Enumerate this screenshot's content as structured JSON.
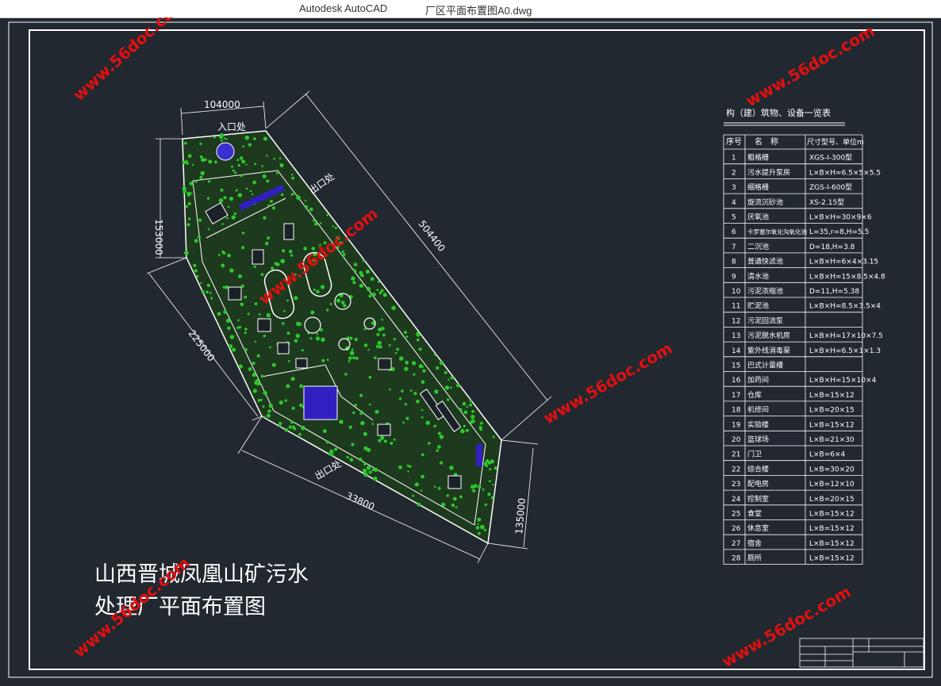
{
  "window": {
    "app_name": "Autodesk AutoCAD",
    "file_name": "厂区平面布置图A0.dwg"
  },
  "drawing": {
    "dimensions": [
      "104000",
      "153000",
      "504400",
      "225000",
      "33800",
      "135000"
    ],
    "labels": {
      "entrance": "入口处",
      "exit_1": "出口处",
      "exit_2": "出口处"
    },
    "title_line_1": "山西晋城凤凰山矿污水",
    "title_line_2": "处理厂平面布置图",
    "watermark": "www.56doc.com"
  },
  "table": {
    "title": "构（建）筑物、设备一览表",
    "headers": [
      "序号",
      "名　称",
      "尺寸型号、单位m"
    ],
    "rows": [
      [
        "1",
        "粗格栅",
        "XGS-I-300型"
      ],
      [
        "2",
        "污水提升泵房",
        "L×B×H=6.5×5×5.5"
      ],
      [
        "3",
        "细格栅",
        "ZGS-I-600型"
      ],
      [
        "4",
        "旋流沉砂池",
        "XS-2.15型"
      ],
      [
        "5",
        "厌氧池",
        "L×B×H=30×9×6"
      ],
      [
        "6",
        "卡罗塞尔氧化沟氧化池",
        "L=35,r=8,H=5.5"
      ],
      [
        "7",
        "二沉池",
        "D=18,H=3.8"
      ],
      [
        "8",
        "普通快滤池",
        "L×B×H=6×4×3.15"
      ],
      [
        "9",
        "清水池",
        "L×B×H=15×8.5×4.8"
      ],
      [
        "10",
        "污泥浓缩池",
        "D=11,H=5.38"
      ],
      [
        "11",
        "贮泥池",
        "L×B×H=8.5×3.5×4"
      ],
      [
        "12",
        "污泥回流泵",
        ""
      ],
      [
        "13",
        "污泥脱水机房",
        "L×B×H=17×10×7.5"
      ],
      [
        "14",
        "紫外线消毒渠",
        "L×B×H=6.5×1×1.3"
      ],
      [
        "15",
        "巴式计量槽",
        ""
      ],
      [
        "16",
        "加药间",
        "L×B×H=15×10×4"
      ],
      [
        "17",
        "仓库",
        "L×B=15×12"
      ],
      [
        "18",
        "机修间",
        "L×B=20×15"
      ],
      [
        "19",
        "实验楼",
        "L×B=15×12"
      ],
      [
        "20",
        "篮球场",
        "L×B=21×30"
      ],
      [
        "21",
        "门卫",
        "L×B=6×4"
      ],
      [
        "22",
        "综合楼",
        "L×B=30×20"
      ],
      [
        "23",
        "配电房",
        "L×B=12×10"
      ],
      [
        "24",
        "控制室",
        "L×B=20×15"
      ],
      [
        "25",
        "食堂",
        "L×B=15×12"
      ],
      [
        "26",
        "休息室",
        "L×B=15×12"
      ],
      [
        "27",
        "宿舍",
        "L×B=15×12"
      ],
      [
        "28",
        "厕所",
        "L×B=15×12"
      ]
    ]
  },
  "colors": {
    "background": "#212830",
    "lines": "#ffffff",
    "trees": "#2ec82e",
    "water": "#3020c0",
    "watermark": "#e01010"
  }
}
